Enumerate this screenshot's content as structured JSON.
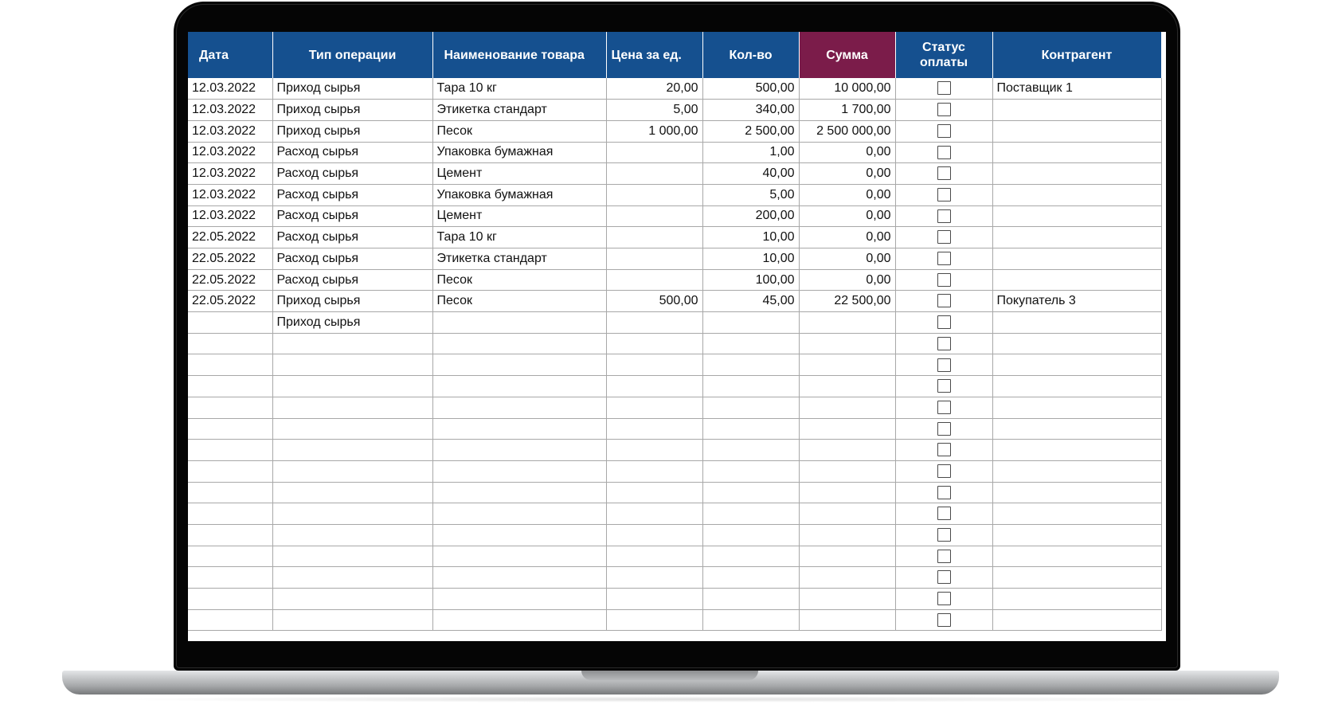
{
  "table": {
    "headers": {
      "date": "Дата",
      "op_type": "Тип операции",
      "product": "Наименование товара",
      "price": "Цена за ед.",
      "qty": "Кол-во",
      "sum": "Сумма",
      "status_line1": "Статус",
      "status_line2": "оплаты",
      "counterparty": "Контрагент"
    },
    "colors": {
      "header_bg": "#15508f",
      "sum_header_bg": "#7b1c4a",
      "header_text": "#ffffff"
    },
    "rows": [
      {
        "date": "12.03.2022",
        "op_type": "Приход сырья",
        "product": "Тара 10 кг",
        "price": "20,00",
        "qty": "500,00",
        "sum": "10 000,00",
        "paid": false,
        "counterparty": "Поставщик 1"
      },
      {
        "date": "12.03.2022",
        "op_type": "Приход сырья",
        "product": "Этикетка стандарт",
        "price": "5,00",
        "qty": "340,00",
        "sum": "1 700,00",
        "paid": false,
        "counterparty": ""
      },
      {
        "date": "12.03.2022",
        "op_type": "Приход сырья",
        "product": "Песок",
        "price": "1 000,00",
        "qty": "2 500,00",
        "sum": "2 500 000,00",
        "paid": false,
        "counterparty": ""
      },
      {
        "date": "12.03.2022",
        "op_type": "Расход сырья",
        "product": "Упаковка бумажная",
        "price": "",
        "qty": "1,00",
        "sum": "0,00",
        "paid": false,
        "counterparty": ""
      },
      {
        "date": "12.03.2022",
        "op_type": "Расход сырья",
        "product": "Цемент",
        "price": "",
        "qty": "40,00",
        "sum": "0,00",
        "paid": false,
        "counterparty": ""
      },
      {
        "date": "12.03.2022",
        "op_type": "Расход сырья",
        "product": "Упаковка бумажная",
        "price": "",
        "qty": "5,00",
        "sum": "0,00",
        "paid": false,
        "counterparty": ""
      },
      {
        "date": "12.03.2022",
        "op_type": "Расход сырья",
        "product": "Цемент",
        "price": "",
        "qty": "200,00",
        "sum": "0,00",
        "paid": false,
        "counterparty": ""
      },
      {
        "date": "22.05.2022",
        "op_type": "Расход сырья",
        "product": "Тара 10 кг",
        "price": "",
        "qty": "10,00",
        "sum": "0,00",
        "paid": false,
        "counterparty": ""
      },
      {
        "date": "22.05.2022",
        "op_type": "Расход сырья",
        "product": "Этикетка стандарт",
        "price": "",
        "qty": "10,00",
        "sum": "0,00",
        "paid": false,
        "counterparty": ""
      },
      {
        "date": "22.05.2022",
        "op_type": "Расход сырья",
        "product": "Песок",
        "price": "",
        "qty": "100,00",
        "sum": "0,00",
        "paid": false,
        "counterparty": ""
      },
      {
        "date": "22.05.2022",
        "op_type": "Приход сырья",
        "product": "Песок",
        "price": "500,00",
        "qty": "45,00",
        "sum": "22 500,00",
        "paid": false,
        "counterparty": "Покупатель 3"
      },
      {
        "date": "",
        "op_type": "Приход сырья",
        "product": "",
        "price": "",
        "qty": "",
        "sum": "",
        "paid": false,
        "counterparty": ""
      },
      {
        "date": "",
        "op_type": "",
        "product": "",
        "price": "",
        "qty": "",
        "sum": "",
        "paid": false,
        "counterparty": ""
      },
      {
        "date": "",
        "op_type": "",
        "product": "",
        "price": "",
        "qty": "",
        "sum": "",
        "paid": false,
        "counterparty": ""
      },
      {
        "date": "",
        "op_type": "",
        "product": "",
        "price": "",
        "qty": "",
        "sum": "",
        "paid": false,
        "counterparty": ""
      },
      {
        "date": "",
        "op_type": "",
        "product": "",
        "price": "",
        "qty": "",
        "sum": "",
        "paid": false,
        "counterparty": ""
      },
      {
        "date": "",
        "op_type": "",
        "product": "",
        "price": "",
        "qty": "",
        "sum": "",
        "paid": false,
        "counterparty": ""
      },
      {
        "date": "",
        "op_type": "",
        "product": "",
        "price": "",
        "qty": "",
        "sum": "",
        "paid": false,
        "counterparty": ""
      },
      {
        "date": "",
        "op_type": "",
        "product": "",
        "price": "",
        "qty": "",
        "sum": "",
        "paid": false,
        "counterparty": ""
      },
      {
        "date": "",
        "op_type": "",
        "product": "",
        "price": "",
        "qty": "",
        "sum": "",
        "paid": false,
        "counterparty": ""
      },
      {
        "date": "",
        "op_type": "",
        "product": "",
        "price": "",
        "qty": "",
        "sum": "",
        "paid": false,
        "counterparty": ""
      },
      {
        "date": "",
        "op_type": "",
        "product": "",
        "price": "",
        "qty": "",
        "sum": "",
        "paid": false,
        "counterparty": ""
      },
      {
        "date": "",
        "op_type": "",
        "product": "",
        "price": "",
        "qty": "",
        "sum": "",
        "paid": false,
        "counterparty": ""
      },
      {
        "date": "",
        "op_type": "",
        "product": "",
        "price": "",
        "qty": "",
        "sum": "",
        "paid": false,
        "counterparty": ""
      },
      {
        "date": "",
        "op_type": "",
        "product": "",
        "price": "",
        "qty": "",
        "sum": "",
        "paid": false,
        "counterparty": ""
      },
      {
        "date": "",
        "op_type": "",
        "product": "",
        "price": "",
        "qty": "",
        "sum": "",
        "paid": false,
        "counterparty": ""
      }
    ]
  }
}
